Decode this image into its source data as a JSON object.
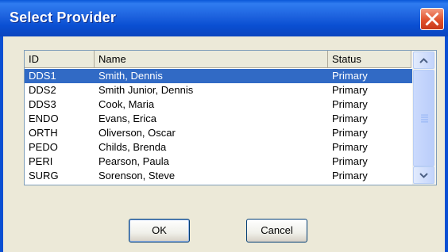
{
  "window": {
    "title": "Select Provider"
  },
  "table": {
    "columns": [
      {
        "label": "ID"
      },
      {
        "label": "Name"
      },
      {
        "label": "Status"
      }
    ],
    "rows": [
      {
        "id": "DDS1",
        "name": "Smith, Dennis",
        "status": "Primary",
        "selected": true
      },
      {
        "id": "DDS2",
        "name": "Smith Junior, Dennis",
        "status": "Primary"
      },
      {
        "id": "DDS3",
        "name": "Cook, Maria",
        "status": "Primary"
      },
      {
        "id": "ENDO",
        "name": "Evans, Erica",
        "status": "Primary"
      },
      {
        "id": "ORTH",
        "name": "Oliverson, Oscar",
        "status": "Primary"
      },
      {
        "id": "PEDO",
        "name": "Childs, Brenda",
        "status": "Primary"
      },
      {
        "id": "PERI",
        "name": "Pearson, Paula",
        "status": "Primary"
      },
      {
        "id": "SURG",
        "name": "Sorenson, Steve",
        "status": "Primary"
      }
    ]
  },
  "buttons": {
    "ok": "OK",
    "cancel": "Cancel"
  },
  "colors": {
    "titlebar": "#0a4fd2",
    "selection": "#316ac5",
    "close": "#e0512c",
    "dialog": "#ece9d8"
  }
}
